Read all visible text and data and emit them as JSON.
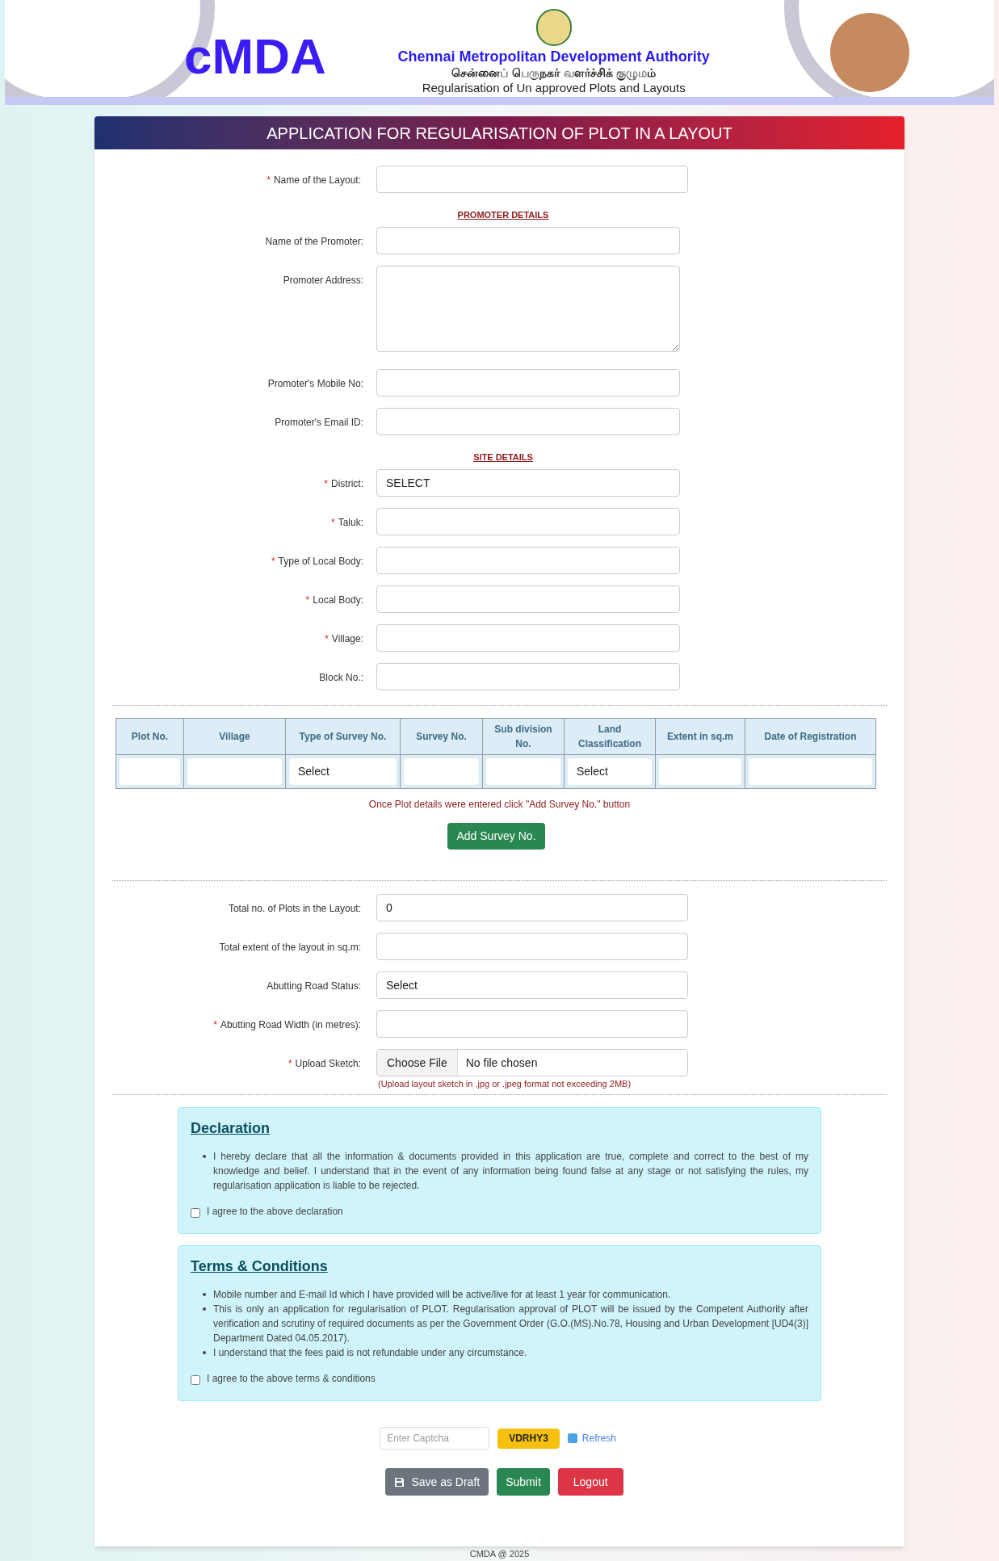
{
  "header": {
    "logo": "cMDA",
    "title": "Chennai Metropolitan Development Authority",
    "subtitle_tamil": "சென்னைப் பெருநகர் வளர்ச்சிக் குழுமம்",
    "subtitle": "Regularisation of Un approved Plots and Layouts"
  },
  "form_title": "APPLICATION FOR REGULARISATION OF PLOT IN A LAYOUT",
  "site_section": [
    {
      "kind": "input",
      "label": "Name of the Layout:",
      "required_mark": "*"
    },
    {
      "kind": "heading",
      "text": "PROMOTER DETAILS"
    },
    {
      "kind": "input",
      "label": "Name of the Promoter:"
    },
    {
      "kind": "textarea",
      "label": "Promoter Address:"
    },
    {
      "kind": "input",
      "label": "Promoter's Mobile No:"
    },
    {
      "kind": "input",
      "label": "Promoter's Email ID:"
    },
    {
      "kind": "heading",
      "text": "SITE DETAILS"
    },
    {
      "kind": "select",
      "label": "District:",
      "required_mark": "*",
      "value": "SELECT"
    },
    {
      "kind": "select",
      "label": "Taluk:",
      "required_mark": "*"
    },
    {
      "kind": "select",
      "label": "Type of Local Body:",
      "required_mark": "*"
    },
    {
      "kind": "select",
      "label": "Local Body:",
      "required_mark": "*"
    },
    {
      "kind": "select",
      "label": "Village:",
      "required_mark": "*"
    },
    {
      "kind": "input",
      "label": "Block No.:"
    }
  ],
  "survey_table": {
    "columns": [
      "Plot No.",
      "Village",
      "Type of Survey No.",
      "Survey No.",
      "Sub division No.",
      "Land Classification",
      "Extent in sq.m",
      "Date of Registration"
    ],
    "row": [
      {
        "kind": "input"
      },
      {
        "kind": "input"
      },
      {
        "kind": "select",
        "value": "Select"
      },
      {
        "kind": "input"
      },
      {
        "kind": "input"
      },
      {
        "kind": "select",
        "value": "Select"
      },
      {
        "kind": "input"
      },
      {
        "kind": "input"
      }
    ]
  },
  "table_note": "Once Plot details were entered click \"Add Survey No.\" button",
  "add_button": "Add Survey No.",
  "layout_section": [
    {
      "kind": "input",
      "label": "Total no. of Plots in the Layout:",
      "value": "0"
    },
    {
      "kind": "input",
      "label": "Total extent of the layout in sq.m:"
    },
    {
      "kind": "select",
      "label": "Abutting Road Status:",
      "value": "Select"
    },
    {
      "kind": "input",
      "label": "Abutting Road Width (in metres):",
      "required_mark": "*"
    },
    {
      "kind": "file",
      "label": "Upload Sketch:",
      "required_mark": "*",
      "button": "Choose File",
      "value": "No file chosen",
      "hint": "(Upload layout sketch in .jpg or .jpeg format not exceeding 2MB)"
    }
  ],
  "declaration": {
    "title": "Declaration",
    "points": [
      "I hereby declare that all the information & documents provided in this application are true, complete and correct to the best of my knowledge and belief. I understand that in the event of any information being found false at any stage or not satisfying the rules, my regularisation application is liable to be rejected."
    ],
    "agree": "I agree to the above declaration",
    "checked": false
  },
  "terms": {
    "title": "Terms & Conditions",
    "points": [
      "Mobile number and E-mail Id which I have provided will be active/live for at least 1 year for communication.",
      "This is only an application for regularisation of PLOT. Regularisation approval of PLOT will be issued by the Competent Authority after verification and scrutiny of required documents as per the Government Order (G.O.(MS).No.78, Housing and Urban Development [UD4(3)] Department Dated 04.05.2017).",
      "I understand that the fees paid is not refundable under any circumstance."
    ],
    "agree": "I agree to the above terms & conditions",
    "checked": false
  },
  "captcha": {
    "placeholder": "Enter Captcha",
    "code": "VDRHY3",
    "refresh": "Refresh"
  },
  "buttons": [
    {
      "kind": "draft",
      "label": "Save as Draft"
    },
    {
      "kind": "submit",
      "label": "Submit"
    },
    {
      "kind": "logout",
      "label": "Logout"
    }
  ],
  "footer": "CMDA @ 2025"
}
